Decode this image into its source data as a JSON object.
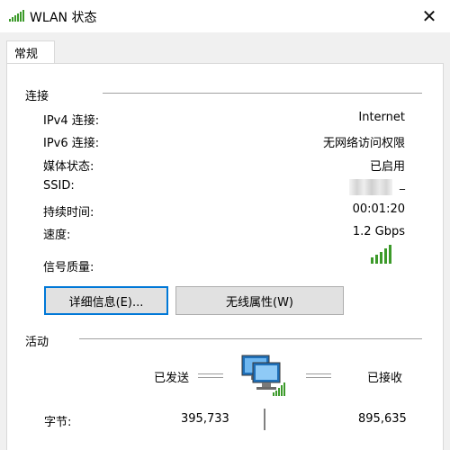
{
  "window": {
    "title": "WLAN 状态",
    "close_glyph": "✕",
    "icons": {
      "title": "wifi-signal-icon",
      "close": "close-icon",
      "network": "network-computers-icon",
      "signal": "signal-bars-icon"
    }
  },
  "tabs": [
    {
      "label": "常规"
    }
  ],
  "connection": {
    "header": "连接",
    "rows": [
      {
        "label": "IPv4 连接:",
        "value": "Internet"
      },
      {
        "label": "IPv6 连接:",
        "value": "无网络访问权限"
      },
      {
        "label": "媒体状态:",
        "value": "已启用"
      },
      {
        "label": "SSID:",
        "value": "_"
      },
      {
        "label": "持续时间:",
        "value": "00:01:20"
      },
      {
        "label": "速度:",
        "value": "1.2 Gbps"
      }
    ],
    "signal_label": "信号质量:",
    "signal_bars_lit": 5,
    "signal_bars_total": 5
  },
  "buttons": {
    "details": "详细信息(E)...",
    "wireless_properties": "无线属性(W)"
  },
  "activity": {
    "header": "活动",
    "sent_label": "已发送",
    "received_label": "已接收",
    "bytes_label": "字节:",
    "bytes_sent": "395,733",
    "bytes_received": "895,635"
  },
  "colors": {
    "accent": "#0078d7",
    "signal_green": "#3c9a2a",
    "button_face": "#e1e1e1",
    "dialog_background": "#f0f0f0"
  }
}
